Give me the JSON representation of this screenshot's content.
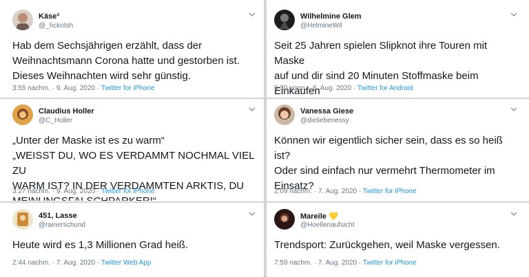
{
  "tweets": [
    {
      "name": "Käse³",
      "handle": "@_hckntsh",
      "text": "Hab dem Sechsjährigen erzählt, dass der\nWeihnachtsmann Corona hatte und gestorben ist.\nDieses Weihnachten wird sehr günstig.",
      "datetime": "3:55 nachm. · 9. Aug. 2020 · ",
      "app": "Twitter for iPhone",
      "avatar_color": "#b9a192"
    },
    {
      "name": "Wilhelmine Glem",
      "handle": "@HelmineWil",
      "text": "Seit 25 Jahren spielen Slipknot ihre Touren mit Maske\nauf und dir sind 20 Minuten Stoffmaske beim Einkaufen\nzu lang. Krieg dich mal sortiert, Brigitte.",
      "datetime": "9:30 vorm. · 6. Aug. 2020 · ",
      "app": "Twitter for Android",
      "avatar_color": "#2b2b2b"
    },
    {
      "name": "Claudius Holler",
      "handle": "@C_Holler",
      "text": "„Unter der Maske ist es zu warm“\n„WEISST DU, WO ES VERDAMMT NOCHMAL VIEL ZU\nWARM IST? IN DER VERDAMMTEN ARKTIS, DU\nMEINUNGSFALSCHPARKER!“",
      "datetime": "3:27 nachm. · 9. Aug. 2020 · ",
      "app": "Twitter for iPhone",
      "avatar_color": "#c8862f"
    },
    {
      "name": "Vanessa Giese",
      "handle": "@dieliebenessy",
      "text": "Können wir eigentlich sicher sein, dass es so heiß ist?\nOder sind einfach nur vermehrt Thermometer im\nEinsatz?",
      "datetime": "2:09 nachm. · 7. Aug. 2020 · ",
      "app": "Twitter for iPhone",
      "avatar_color": "#8a5a3c"
    },
    {
      "name": "451, Lasse",
      "handle": "@rainerschund",
      "text": "Heute wird es 1,3 Millionen Grad heiß.",
      "datetime": "2:44 nachm. · 7. Aug. 2020 · ",
      "app": "Twitter Web App",
      "avatar_color": "#d4a56a"
    },
    {
      "name": "Mareile 💛",
      "handle": "@Hoellenaufsicht",
      "text": "Trendsport: Zurückgehen, weil Maske vergessen.",
      "datetime": "7:59 nachm. · 7. Aug. 2020 · ",
      "app": "Twitter for iPhone",
      "avatar_color": "#3a1f1a"
    }
  ],
  "colors": {
    "link": "#1b95e0",
    "muted": "#657786",
    "text": "#14171a",
    "separator": "#cfd4d8"
  }
}
